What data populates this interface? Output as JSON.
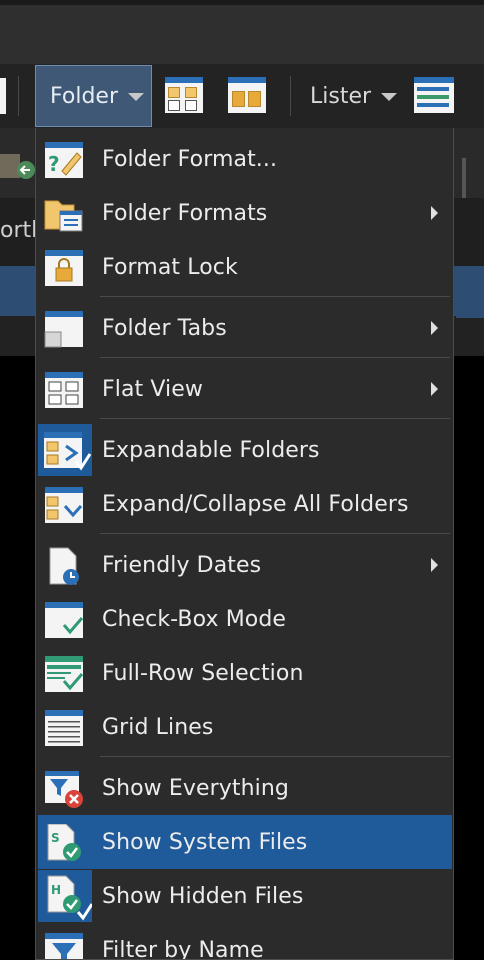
{
  "toolbar": {
    "folder_label": "Folder",
    "lister_label": "Lister"
  },
  "background": {
    "partial_text": "ortla"
  },
  "menu": {
    "items": [
      {
        "label": "Folder Format...",
        "icon": "folder-format-icon",
        "submenu": false
      },
      {
        "label": "Folder Formats",
        "icon": "folder-formats-icon",
        "submenu": true
      },
      {
        "label": "Format Lock",
        "icon": "format-lock-icon",
        "submenu": false
      },
      {
        "label": "Folder Tabs",
        "icon": "folder-tabs-icon",
        "submenu": true
      },
      {
        "label": "Flat View",
        "icon": "flat-view-icon",
        "submenu": true
      },
      {
        "label": "Expandable Folders",
        "icon": "expandable-folders-icon",
        "submenu": false,
        "checked": true
      },
      {
        "label": "Expand/Collapse All Folders",
        "icon": "expand-collapse-icon",
        "submenu": false
      },
      {
        "label": "Friendly Dates",
        "icon": "friendly-dates-icon",
        "submenu": true
      },
      {
        "label": "Check-Box Mode",
        "icon": "checkbox-mode-icon",
        "submenu": false
      },
      {
        "label": "Full-Row Selection",
        "icon": "full-row-selection-icon",
        "submenu": false
      },
      {
        "label": "Grid Lines",
        "icon": "grid-lines-icon",
        "submenu": false
      },
      {
        "label": "Show Everything",
        "icon": "show-everything-icon",
        "submenu": false
      },
      {
        "label": "Show System Files",
        "icon": "show-system-files-icon",
        "submenu": false,
        "selected": true
      },
      {
        "label": "Show Hidden Files",
        "icon": "show-hidden-files-icon",
        "submenu": false,
        "checked": true
      },
      {
        "label": "Filter by Name",
        "icon": "filter-by-name-icon",
        "submenu": false
      }
    ]
  },
  "colors": {
    "accent": "#1f5b9a",
    "menu_bg": "#2b2b2b",
    "toolbar_active": "#3f5875"
  }
}
